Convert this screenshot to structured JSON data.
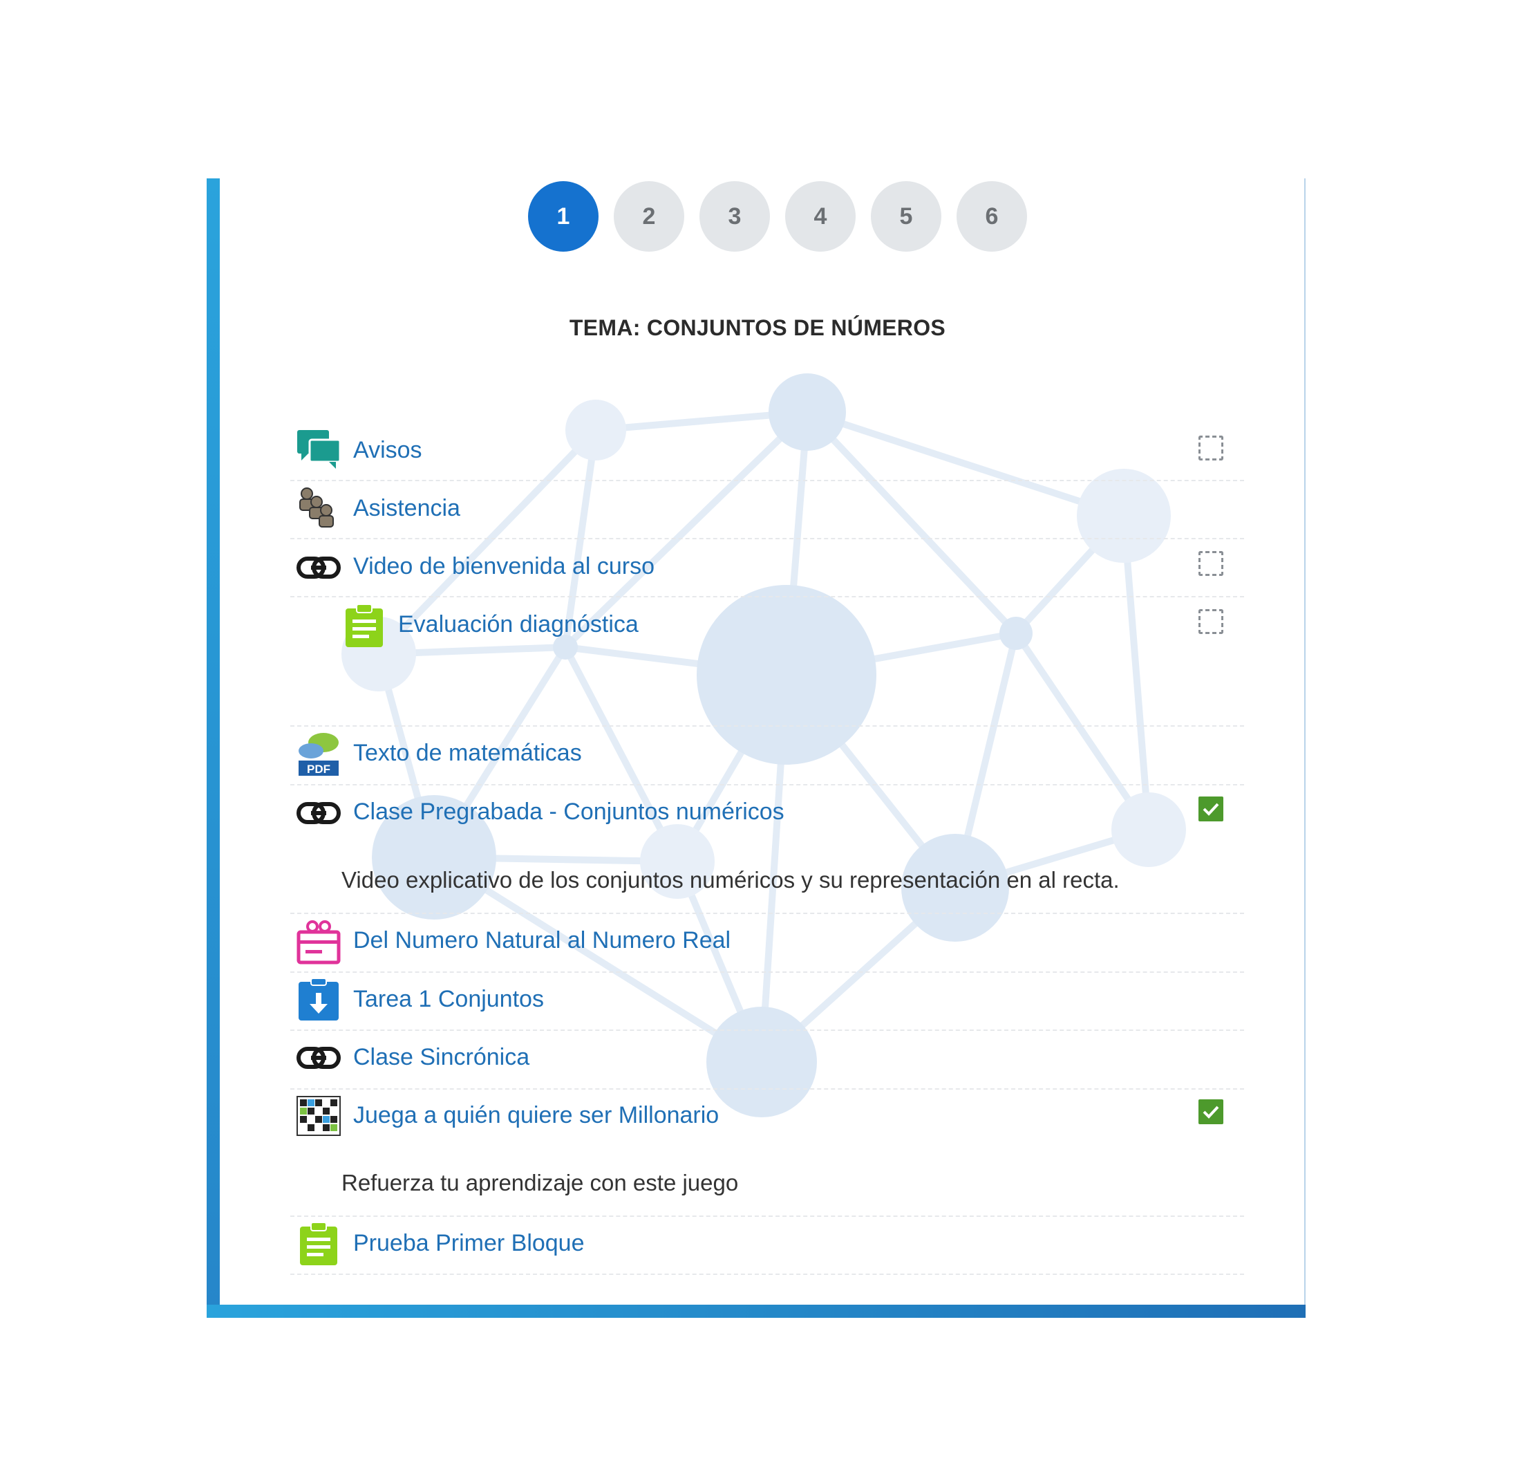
{
  "pagination": {
    "pages": [
      "1",
      "2",
      "3",
      "4",
      "5",
      "6"
    ],
    "active": "1"
  },
  "section": {
    "title": "TEMA: CONJUNTOS DE NÚMEROS"
  },
  "activities": [
    {
      "label": "Avisos",
      "icon": "forum-icon",
      "completion": "manual-incomplete"
    },
    {
      "label": "Asistencia",
      "icon": "attendance-icon",
      "completion": "none"
    },
    {
      "label": "Video de bienvenida al curso",
      "icon": "link-icon",
      "completion": "manual-incomplete"
    },
    {
      "label": "Evaluación diagnóstica",
      "icon": "quiz-icon",
      "completion": "manual-incomplete"
    },
    {
      "label": "Texto de matemáticas",
      "icon": "pdf-icon",
      "completion": "none"
    },
    {
      "label": "Clase Pregrabada - Conjuntos numéricos",
      "icon": "link-icon",
      "completion": "complete",
      "description": "Video explicativo de los conjuntos numéricos y su representación en al recta."
    },
    {
      "label": "Del Numero Natural al Numero Real",
      "icon": "gift-lesson-icon",
      "completion": "none"
    },
    {
      "label": "Tarea 1 Conjuntos",
      "icon": "assignment-icon",
      "completion": "none"
    },
    {
      "label": "Clase Sincrónica",
      "icon": "link-icon",
      "completion": "none"
    },
    {
      "label": "Juega a quién quiere ser Millonario",
      "icon": "game-icon",
      "completion": "complete",
      "description": "Refuerza tu aprendizaje con este juego"
    },
    {
      "label": "Prueba Primer Bloque",
      "icon": "quiz-icon",
      "completion": "none"
    }
  ],
  "colors": {
    "accent": "#1572cf",
    "link": "#1f6fb5",
    "complete": "#4d9a2c",
    "network": "#dbe7f4",
    "border_gradient_start": "#2aa3dc",
    "border_gradient_end": "#1f6fb6"
  }
}
